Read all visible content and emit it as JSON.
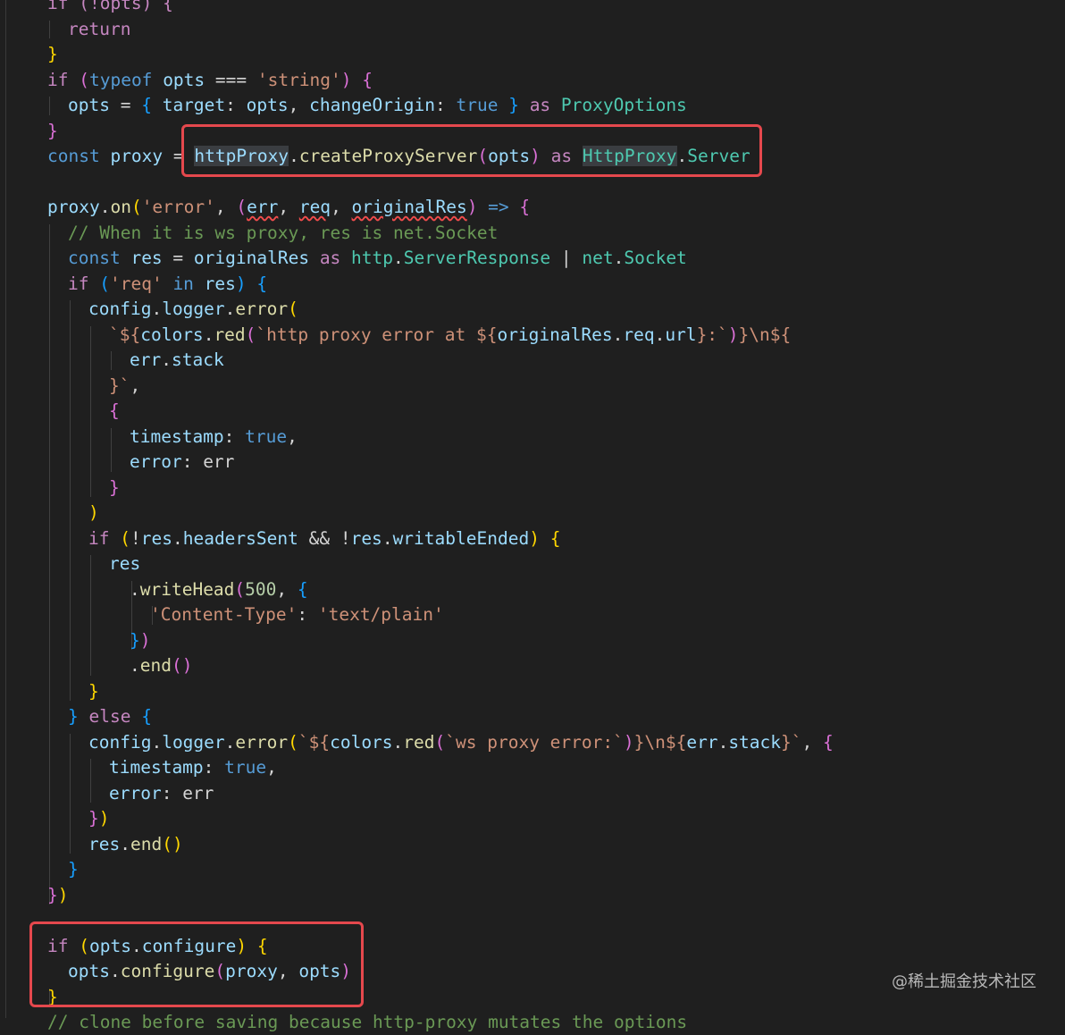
{
  "colors": {
    "background": "#1f1f1f",
    "keyword": "#569cd6",
    "control": "#c586c0",
    "variable": "#9cdcfe",
    "function": "#dcdcaa",
    "string": "#ce9178",
    "type": "#4ec9b0",
    "comment": "#6a9955",
    "number": "#b5cea8",
    "plain": "#d4d4d4",
    "bracket1": "#ffd700",
    "bracket2": "#da70d6",
    "bracket3": "#179fff",
    "highlight_border": "#e5484d"
  },
  "lines": [
    {
      "indent": 0,
      "tokens": [
        [
          "if (!opts) {",
          "control"
        ]
      ]
    },
    {
      "indent": 1,
      "tokens": [
        [
          "return",
          "control"
        ]
      ]
    },
    {
      "indent": 0,
      "tokens": [
        [
          "}",
          "bracket1"
        ]
      ]
    },
    {
      "indent": 0,
      "tokens": [
        [
          "if",
          "control"
        ],
        [
          " ",
          "plain"
        ],
        [
          "(",
          "bracket2"
        ],
        [
          "typeof",
          "keyword"
        ],
        [
          " ",
          "plain"
        ],
        [
          "opts",
          "variable"
        ],
        [
          " === ",
          "plain"
        ],
        [
          "'string'",
          "string"
        ],
        [
          ")",
          "bracket2"
        ],
        [
          " ",
          "plain"
        ],
        [
          "{",
          "bracket2"
        ]
      ]
    },
    {
      "indent": 1,
      "tokens": [
        [
          "opts",
          "variable"
        ],
        [
          " = ",
          "plain"
        ],
        [
          "{",
          "bracket3"
        ],
        [
          " ",
          "plain"
        ],
        [
          "target",
          "variable"
        ],
        [
          ": ",
          "plain"
        ],
        [
          "opts",
          "variable"
        ],
        [
          ", ",
          "plain"
        ],
        [
          "changeOrigin",
          "variable"
        ],
        [
          ": ",
          "plain"
        ],
        [
          "true",
          "keyword"
        ],
        [
          " ",
          "plain"
        ],
        [
          "}",
          "bracket3"
        ],
        [
          " ",
          "plain"
        ],
        [
          "as",
          "control"
        ],
        [
          " ",
          "plain"
        ],
        [
          "ProxyOptions",
          "type"
        ]
      ]
    },
    {
      "indent": 0,
      "tokens": [
        [
          "}",
          "bracket2"
        ]
      ]
    },
    {
      "indent": 0,
      "tokens": [
        [
          "const",
          "keyword"
        ],
        [
          " ",
          "plain"
        ],
        [
          "proxy",
          "variable"
        ],
        [
          " = ",
          "plain"
        ],
        [
          "httpProxy",
          "variable"
        ],
        [
          ".",
          "plain"
        ],
        [
          "createProxyServer",
          "function"
        ],
        [
          "(",
          "bracket2"
        ],
        [
          "opts",
          "variable"
        ],
        [
          ")",
          "bracket2"
        ],
        [
          " ",
          "plain"
        ],
        [
          "as",
          "control"
        ],
        [
          " ",
          "plain"
        ],
        [
          "HttpProxy",
          "type"
        ],
        [
          ".",
          "plain"
        ],
        [
          "Server",
          "type"
        ]
      ]
    },
    {
      "indent": 0,
      "tokens": []
    },
    {
      "indent": 0,
      "tokens": [
        [
          "proxy",
          "variable"
        ],
        [
          ".",
          "plain"
        ],
        [
          "on",
          "function"
        ],
        [
          "(",
          "bracket1"
        ],
        [
          "'error'",
          "string"
        ],
        [
          ", ",
          "plain"
        ],
        [
          "(",
          "bracket2"
        ],
        [
          "err",
          "variable"
        ],
        [
          ", ",
          "plain"
        ],
        [
          "req",
          "variable"
        ],
        [
          ", ",
          "plain"
        ],
        [
          "originalRes",
          "variable"
        ],
        [
          ")",
          "bracket2"
        ],
        [
          " => ",
          "keyword"
        ],
        [
          "{",
          "bracket2"
        ]
      ]
    },
    {
      "indent": 1,
      "tokens": [
        [
          "// When it is ws proxy, res is net.Socket",
          "comment"
        ]
      ]
    },
    {
      "indent": 1,
      "tokens": [
        [
          "const",
          "keyword"
        ],
        [
          " ",
          "plain"
        ],
        [
          "res",
          "variable"
        ],
        [
          " = ",
          "plain"
        ],
        [
          "originalRes",
          "variable"
        ],
        [
          " ",
          "plain"
        ],
        [
          "as",
          "control"
        ],
        [
          " ",
          "plain"
        ],
        [
          "http",
          "type"
        ],
        [
          ".",
          "plain"
        ],
        [
          "ServerResponse",
          "type"
        ],
        [
          " | ",
          "plain"
        ],
        [
          "net",
          "type"
        ],
        [
          ".",
          "plain"
        ],
        [
          "Socket",
          "type"
        ]
      ]
    },
    {
      "indent": 1,
      "tokens": [
        [
          "if",
          "control"
        ],
        [
          " ",
          "plain"
        ],
        [
          "(",
          "bracket3"
        ],
        [
          "'req'",
          "string"
        ],
        [
          " ",
          "plain"
        ],
        [
          "in",
          "keyword"
        ],
        [
          " ",
          "plain"
        ],
        [
          "res",
          "variable"
        ],
        [
          ")",
          "bracket3"
        ],
        [
          " ",
          "plain"
        ],
        [
          "{",
          "bracket3"
        ]
      ]
    },
    {
      "indent": 2,
      "tokens": [
        [
          "config",
          "variable"
        ],
        [
          ".",
          "plain"
        ],
        [
          "logger",
          "variable"
        ],
        [
          ".",
          "plain"
        ],
        [
          "error",
          "function"
        ],
        [
          "(",
          "bracket1"
        ]
      ]
    },
    {
      "indent": 3,
      "tokens": [
        [
          "`${",
          "string"
        ],
        [
          "colors",
          "variable"
        ],
        [
          ".",
          "plain"
        ],
        [
          "red",
          "function"
        ],
        [
          "(",
          "bracket2"
        ],
        [
          "`http proxy error at ${",
          "string"
        ],
        [
          "originalRes",
          "variable"
        ],
        [
          ".",
          "plain"
        ],
        [
          "req",
          "variable"
        ],
        [
          ".",
          "plain"
        ],
        [
          "url",
          "variable"
        ],
        [
          "}:`",
          "string"
        ],
        [
          ")",
          "bracket2"
        ],
        [
          "}\\n${",
          "string"
        ]
      ]
    },
    {
      "indent": 4,
      "tokens": [
        [
          "err",
          "variable"
        ],
        [
          ".",
          "plain"
        ],
        [
          "stack",
          "variable"
        ]
      ]
    },
    {
      "indent": 3,
      "tokens": [
        [
          "}`",
          "string"
        ],
        [
          ",",
          "plain"
        ]
      ]
    },
    {
      "indent": 3,
      "tokens": [
        [
          "{",
          "bracket2"
        ]
      ]
    },
    {
      "indent": 4,
      "tokens": [
        [
          "timestamp",
          "variable"
        ],
        [
          ": ",
          "plain"
        ],
        [
          "true",
          "keyword"
        ],
        [
          ",",
          "plain"
        ]
      ]
    },
    {
      "indent": 4,
      "tokens": [
        [
          "error",
          "variable"
        ],
        [
          ": ",
          "plain"
        ],
        [
          "err",
          "plain"
        ]
      ]
    },
    {
      "indent": 3,
      "tokens": [
        [
          "}",
          "bracket2"
        ]
      ]
    },
    {
      "indent": 2,
      "tokens": [
        [
          ")",
          "bracket1"
        ]
      ]
    },
    {
      "indent": 2,
      "tokens": [
        [
          "if",
          "control"
        ],
        [
          " ",
          "plain"
        ],
        [
          "(",
          "bracket1"
        ],
        [
          "!",
          "plain"
        ],
        [
          "res",
          "variable"
        ],
        [
          ".",
          "plain"
        ],
        [
          "headersSent",
          "variable"
        ],
        [
          " && ",
          "plain"
        ],
        [
          "!",
          "plain"
        ],
        [
          "res",
          "variable"
        ],
        [
          ".",
          "plain"
        ],
        [
          "writableEnded",
          "variable"
        ],
        [
          ")",
          "bracket1"
        ],
        [
          " ",
          "plain"
        ],
        [
          "{",
          "bracket1"
        ]
      ]
    },
    {
      "indent": 3,
      "tokens": [
        [
          "res",
          "variable"
        ]
      ]
    },
    {
      "indent": 4,
      "tokens": [
        [
          ".",
          "plain"
        ],
        [
          "writeHead",
          "function"
        ],
        [
          "(",
          "bracket2"
        ],
        [
          "500",
          "number"
        ],
        [
          ", ",
          "plain"
        ],
        [
          "{",
          "bracket3"
        ]
      ]
    },
    {
      "indent": 5,
      "tokens": [
        [
          "'Content-Type'",
          "string"
        ],
        [
          ": ",
          "plain"
        ],
        [
          "'text/plain'",
          "string"
        ]
      ]
    },
    {
      "indent": 4,
      "tokens": [
        [
          "}",
          "bracket3"
        ],
        [
          ")",
          "bracket2"
        ]
      ]
    },
    {
      "indent": 4,
      "tokens": [
        [
          ".",
          "plain"
        ],
        [
          "end",
          "function"
        ],
        [
          "()",
          "bracket2"
        ]
      ]
    },
    {
      "indent": 2,
      "tokens": [
        [
          "}",
          "bracket1"
        ]
      ]
    },
    {
      "indent": 1,
      "tokens": [
        [
          "}",
          "bracket3"
        ],
        [
          " ",
          "plain"
        ],
        [
          "else",
          "control"
        ],
        [
          " ",
          "plain"
        ],
        [
          "{",
          "bracket3"
        ]
      ]
    },
    {
      "indent": 2,
      "tokens": [
        [
          "config",
          "variable"
        ],
        [
          ".",
          "plain"
        ],
        [
          "logger",
          "variable"
        ],
        [
          ".",
          "plain"
        ],
        [
          "error",
          "function"
        ],
        [
          "(",
          "bracket1"
        ],
        [
          "`${",
          "string"
        ],
        [
          "colors",
          "variable"
        ],
        [
          ".",
          "plain"
        ],
        [
          "red",
          "function"
        ],
        [
          "(",
          "bracket2"
        ],
        [
          "`ws proxy error:`",
          "string"
        ],
        [
          ")",
          "bracket2"
        ],
        [
          "}\\n${",
          "string"
        ],
        [
          "err",
          "variable"
        ],
        [
          ".",
          "plain"
        ],
        [
          "stack",
          "variable"
        ],
        [
          "}`",
          "string"
        ],
        [
          ", ",
          "plain"
        ],
        [
          "{",
          "bracket2"
        ]
      ]
    },
    {
      "indent": 3,
      "tokens": [
        [
          "timestamp",
          "variable"
        ],
        [
          ": ",
          "plain"
        ],
        [
          "true",
          "keyword"
        ],
        [
          ",",
          "plain"
        ]
      ]
    },
    {
      "indent": 3,
      "tokens": [
        [
          "error",
          "variable"
        ],
        [
          ": ",
          "plain"
        ],
        [
          "err",
          "plain"
        ]
      ]
    },
    {
      "indent": 2,
      "tokens": [
        [
          "}",
          "bracket2"
        ],
        [
          ")",
          "bracket1"
        ]
      ]
    },
    {
      "indent": 2,
      "tokens": [
        [
          "res",
          "variable"
        ],
        [
          ".",
          "plain"
        ],
        [
          "end",
          "function"
        ],
        [
          "()",
          "bracket1"
        ]
      ]
    },
    {
      "indent": 1,
      "tokens": [
        [
          "}",
          "bracket3"
        ]
      ]
    },
    {
      "indent": 0,
      "tokens": [
        [
          "}",
          "bracket2"
        ],
        [
          ")",
          "bracket1"
        ]
      ]
    },
    {
      "indent": 0,
      "tokens": []
    },
    {
      "indent": 0,
      "tokens": [
        [
          "if",
          "control"
        ],
        [
          " ",
          "plain"
        ],
        [
          "(",
          "bracket1"
        ],
        [
          "opts",
          "variable"
        ],
        [
          ".",
          "plain"
        ],
        [
          "configure",
          "variable"
        ],
        [
          ")",
          "bracket1"
        ],
        [
          " ",
          "plain"
        ],
        [
          "{",
          "bracket1"
        ]
      ]
    },
    {
      "indent": 1,
      "tokens": [
        [
          "opts",
          "variable"
        ],
        [
          ".",
          "plain"
        ],
        [
          "configure",
          "function"
        ],
        [
          "(",
          "bracket2"
        ],
        [
          "proxy",
          "variable"
        ],
        [
          ", ",
          "plain"
        ],
        [
          "opts",
          "variable"
        ],
        [
          ")",
          "bracket2"
        ]
      ]
    },
    {
      "indent": 0,
      "tokens": [
        [
          "}",
          "bracket1"
        ]
      ]
    },
    {
      "indent": 0,
      "tokens": [
        [
          "// clone before saving because http-proxy mutates the options",
          "comment"
        ]
      ]
    }
  ],
  "watermark": "@稀土掘金技术社区"
}
